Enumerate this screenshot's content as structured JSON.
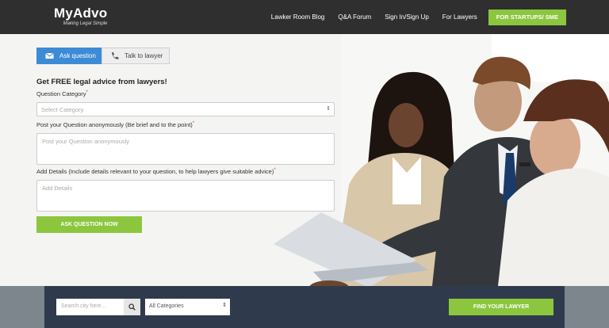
{
  "header": {
    "logo_main": "MyAdvo",
    "logo_tagline": "Making Legal Simple",
    "nav": [
      {
        "label": "Lawker Room Blog"
      },
      {
        "label": "Q&A Forum"
      },
      {
        "label": "Sign In/Sign Up"
      },
      {
        "label": "For Lawyers"
      }
    ],
    "cta_label": "FOR STARTUPS/ SME"
  },
  "form": {
    "tabs": [
      {
        "label": "Ask question",
        "icon": "envelope-icon",
        "active": true
      },
      {
        "label": "Talk to lawyer",
        "icon": "phone-icon",
        "active": false
      }
    ],
    "title": "Get FREE legal advice from lawyers!",
    "category_label": "Question Category",
    "category_placeholder": "Select Category",
    "question_label": "Post your Question anonymously (Be brief and to the point)",
    "question_placeholder": "Post your Question anonymously",
    "details_label": "Add Details (Include details relevant to your question, to help lawyers give suitable advice)",
    "details_placeholder": "Add Details",
    "submit_label": "ASK QUESTION NOW",
    "required_mark": "*"
  },
  "search": {
    "city_placeholder": "Search city here...",
    "category_value": "All Categories",
    "find_label": "FIND YOUR LAWYER"
  },
  "colors": {
    "accent_green": "#8cc63f",
    "tab_blue": "#3d8bd6",
    "header_bg": "#2f2f2f",
    "search_bar_bg": "#2f3b4c"
  }
}
